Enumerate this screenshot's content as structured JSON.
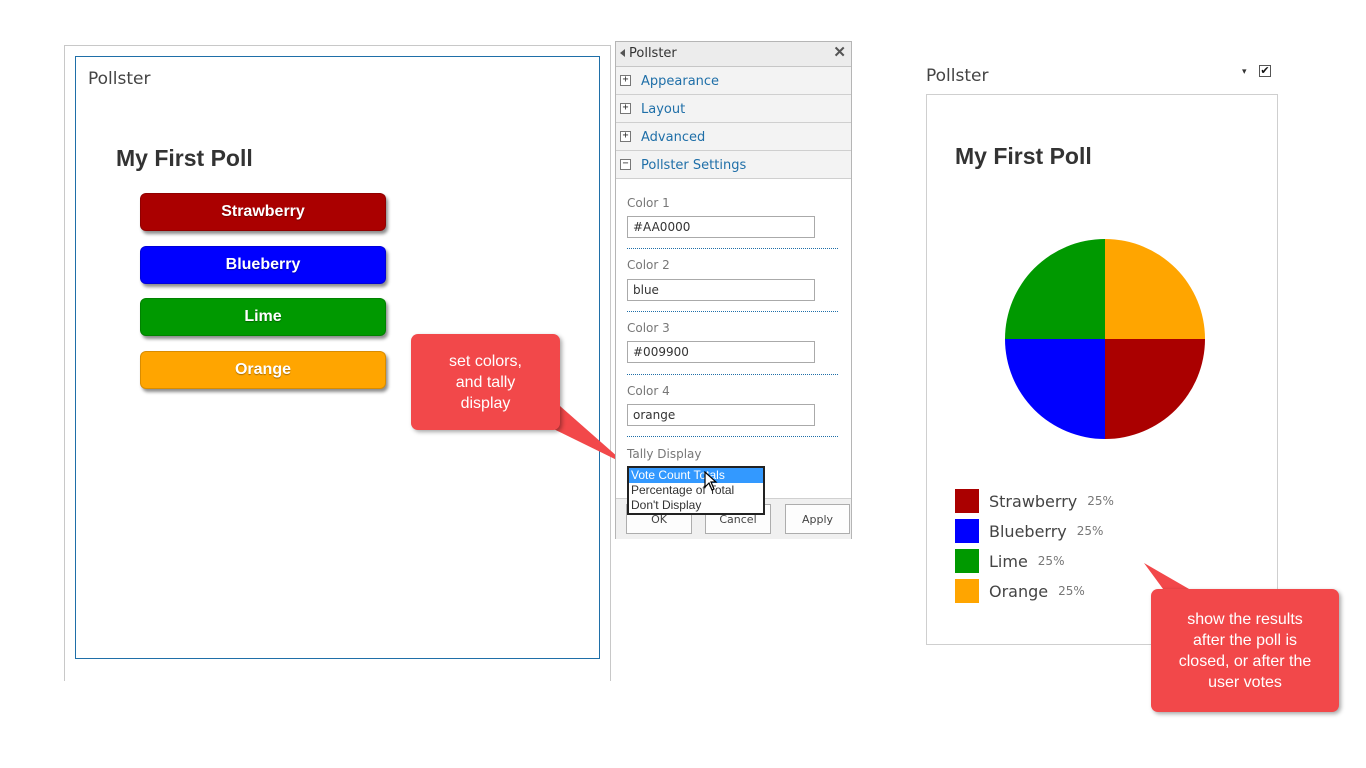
{
  "colors": {
    "strawberry": "#AA0000",
    "blueberry": "#0000FF",
    "lime": "#009900",
    "orange": "#FFA500",
    "callout": "#F2484A",
    "link": "#1F6FA8"
  },
  "left_part": {
    "title": "Pollster",
    "poll_title": "My First Poll",
    "options": [
      "Strawberry",
      "Blueberry",
      "Lime",
      "Orange"
    ]
  },
  "callouts": {
    "left": "set colors, and tally display",
    "right": "show the results after the poll is closed, or after the user votes"
  },
  "tool_pane": {
    "title": "Pollster",
    "close_icon": "✕",
    "sections": [
      {
        "label": "Appearance",
        "expanded": false
      },
      {
        "label": "Layout",
        "expanded": false
      },
      {
        "label": "Advanced",
        "expanded": false
      },
      {
        "label": "Pollster Settings",
        "expanded": true
      }
    ],
    "fields": [
      {
        "label": "Color 1",
        "value": "#AA0000"
      },
      {
        "label": "Color 2",
        "value": "blue"
      },
      {
        "label": "Color 3",
        "value": "#009900"
      },
      {
        "label": "Color 4",
        "value": "orange"
      }
    ],
    "tally": {
      "label": "Tally Display",
      "options": [
        "Vote Count Totals",
        "Percentage of Total",
        "Don't Display"
      ],
      "selected": "Vote Count Totals"
    },
    "buttons": {
      "ok": "OK",
      "cancel": "Cancel",
      "apply": "Apply"
    }
  },
  "right_part": {
    "title": "Pollster",
    "menu_icon": "▾",
    "checkbox": "✔",
    "poll_title": "My First Poll",
    "legend": [
      {
        "name": "Strawberry",
        "pct": "25%"
      },
      {
        "name": "Blueberry",
        "pct": "25%"
      },
      {
        "name": "Lime",
        "pct": "25%"
      },
      {
        "name": "Orange",
        "pct": "25%"
      }
    ]
  },
  "chart_data": {
    "type": "pie",
    "categories": [
      "Strawberry",
      "Blueberry",
      "Lime",
      "Orange"
    ],
    "values": [
      25,
      25,
      25,
      25
    ],
    "colors": [
      "#AA0000",
      "#0000FF",
      "#009900",
      "#FFA500"
    ],
    "title": "My First Poll",
    "legend": "bottom-left"
  }
}
